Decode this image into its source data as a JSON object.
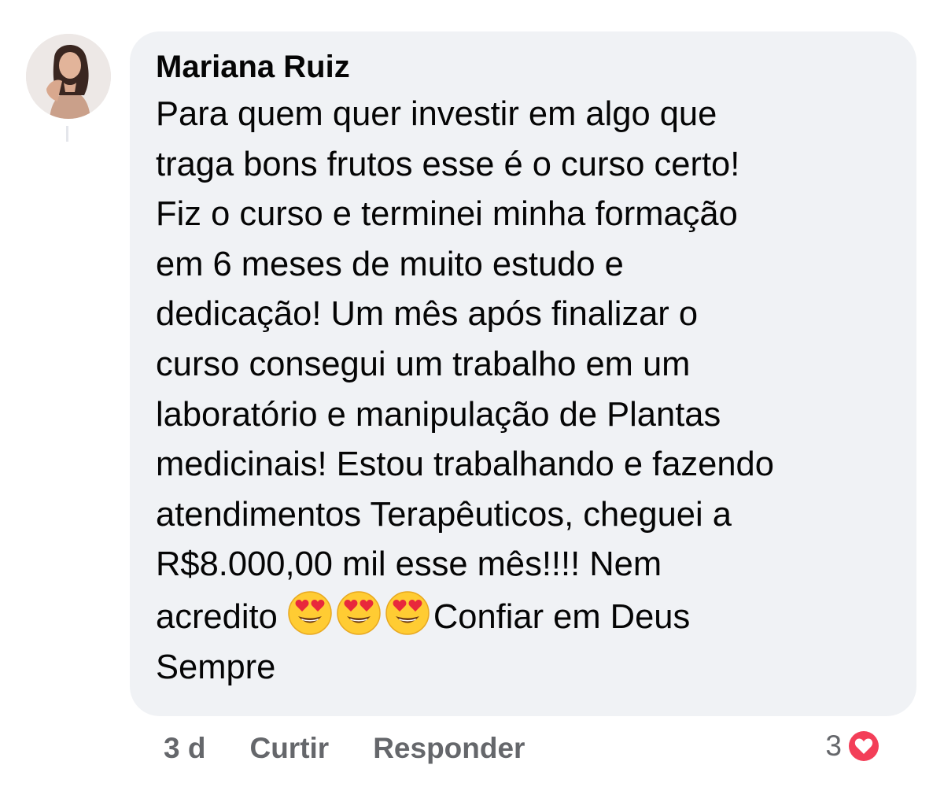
{
  "comment": {
    "author": "Mariana Ruiz",
    "avatar_icon": "user-avatar-photo",
    "lines": [
      "Para quem quer investir em algo que",
      "traga bons frutos esse é o curso certo!",
      "Fiz o curso e terminei minha formação",
      "em 6 meses de muito estudo e",
      "dedicação! Um mês após finalizar o",
      "curso consegui um trabalho em um",
      "laboratório e manipulação de Plantas",
      "medicinais! Estou trabalhando e fazendo",
      "atendimentos Terapêuticos, cheguei a",
      "R$8.000,00 mil esse mês!!!! Nem"
    ],
    "line_with_emoji_start": "acredito",
    "emoji_icon": "heart-eyes-emoji",
    "emoji_count": 3,
    "line_with_emoji_end": "Confiar em Deus",
    "last_line": "Sempre"
  },
  "actions": {
    "time": "3 d",
    "like_label": "Curtir",
    "reply_label": "Responder"
  },
  "reactions": {
    "count": "3",
    "icon": "heart-reaction-icon",
    "color": "#f33e58"
  },
  "colors": {
    "bubble": "#f0f2f5",
    "text": "#050505",
    "secondary": "#65676b"
  }
}
